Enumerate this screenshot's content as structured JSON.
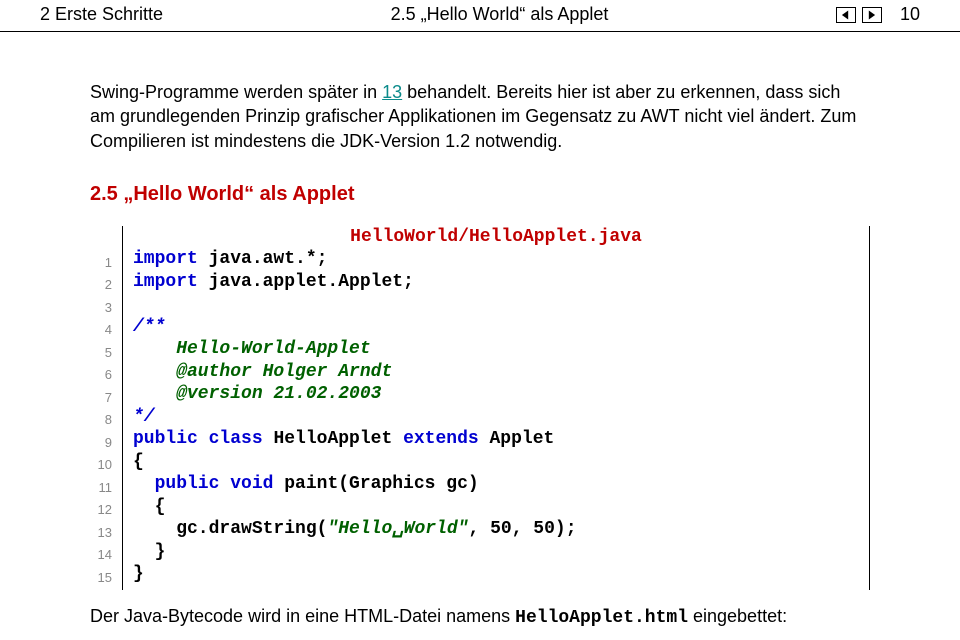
{
  "header": {
    "left": "2 Erste Schritte",
    "center": "2.5 „Hello World“ als Applet",
    "pagenum": "10"
  },
  "intro": {
    "t1": "Swing-Programme werden später in ",
    "ref": "13",
    "t2": " behandelt. Bereits hier ist aber zu erkennen, dass sich am grundlegenden Prinzip grafischer Applikationen im Gegensatz zu AWT nicht viel ändert. Zum Compilieren ist mindestens die JDK-Version 1.2 notwendig."
  },
  "section_heading": "2.5 „Hello World“ als Applet",
  "code": {
    "filename": "HelloWorld/HelloApplet.java",
    "ln": [
      "1",
      "2",
      "3",
      "4",
      "5",
      "6",
      "7",
      "8",
      "9",
      "10",
      "11",
      "12",
      "13",
      "14",
      "15"
    ],
    "l1a": "import",
    "l1b": " java.awt.*;",
    "l2a": "import",
    "l2b": " java.applet.Applet;",
    "l3": "",
    "l4": "/**",
    "l5": "    Hello-World-Applet",
    "l6": "    @author Holger Arndt",
    "l7": "    @version 21.02.2003",
    "l8": "*/",
    "l9a": "public class ",
    "l9b": "HelloApplet ",
    "l9c": "extends",
    "l9d": " Applet",
    "l10": "{",
    "l11a": "  public void ",
    "l11b": "paint(Graphics gc)",
    "l12": "  {",
    "l13a": "    gc.drawString(",
    "l13b": "\"Hello␣World\"",
    "l13c": ", 50, 50);",
    "l14": "  }",
    "l15": "}"
  },
  "after": {
    "t1": "Der Java-Bytecode wird in eine HTML-Datei namens ",
    "fname": "HelloApplet.html",
    "t2": " eingebettet:"
  }
}
